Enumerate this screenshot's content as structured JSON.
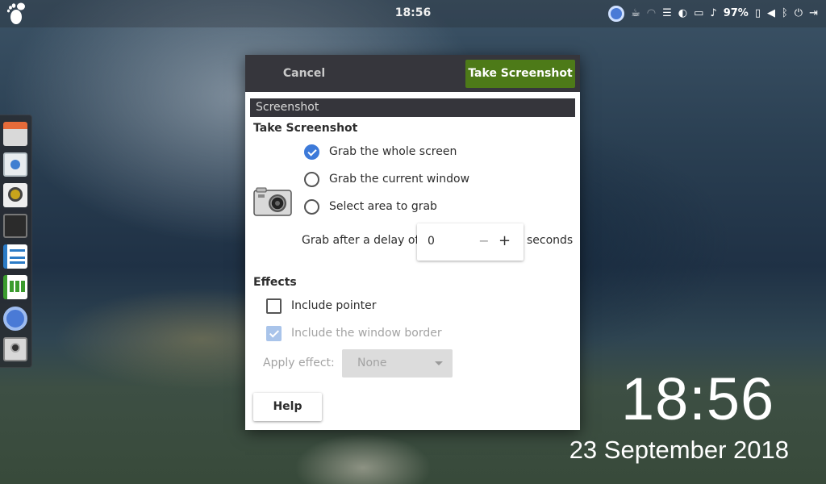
{
  "topbar": {
    "activities_icon": "gnome-foot-icon",
    "clock": "18:56",
    "battery_percent": "97%",
    "tray_icons": [
      "chrome-icon",
      "coffee-cup-icon",
      "wifi-icon",
      "menu-icon",
      "night-light-icon",
      "folder-icon",
      "bell-icon",
      "battery-icon",
      "volume-icon",
      "bluetooth-icon",
      "power-icon",
      "logout-icon"
    ]
  },
  "dock": {
    "items": [
      "file-manager-icon",
      "software-icon",
      "rhythmbox-icon",
      "terminal-icon",
      "writer-icon",
      "calc-icon",
      "chromium-icon",
      "screenshot-icon"
    ]
  },
  "desktop": {
    "time": "18:56",
    "date": "23 September 2018"
  },
  "dialog": {
    "cancel_label": "Cancel",
    "take_label": "Take Screenshot",
    "section_label": "Screenshot",
    "take_title": "Take Screenshot",
    "options": [
      {
        "label": "Grab the whole screen",
        "checked": true
      },
      {
        "label": "Grab the current window",
        "checked": false
      },
      {
        "label": "Select area to grab",
        "checked": false
      }
    ],
    "delay_label": "Grab after a delay of",
    "delay_value": "0",
    "minus": "−",
    "plus": "+",
    "seconds_label": "seconds",
    "effects_title": "Effects",
    "include_pointer_label": "Include pointer",
    "include_pointer_checked": false,
    "include_border_label": "Include the window border",
    "include_border_checked": true,
    "apply_label": "Apply effect:",
    "apply_value": "None",
    "help_label": "Help"
  },
  "colors": {
    "accent_green": "#4d7a18",
    "header_dark": "#36363c",
    "checked_blue": "#3d7ad9"
  }
}
